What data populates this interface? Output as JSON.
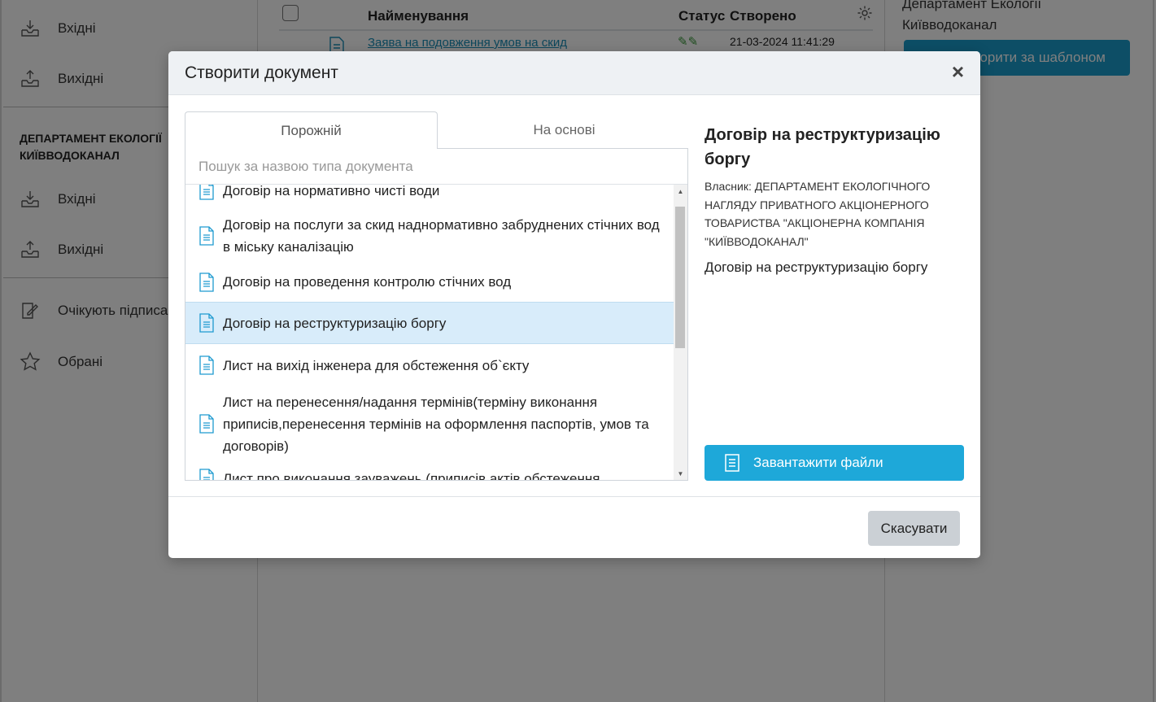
{
  "sidebar": {
    "items_top": [
      {
        "label": "Вхідні",
        "icon": "inbox-download-icon"
      },
      {
        "label": "Вихідні",
        "icon": "outbox-upload-icon"
      }
    ],
    "department_heading": "ДЕПАРТАМЕНТ ЕКОЛОГІЇ КИЇВВОДОКАНАЛ",
    "items_dept": [
      {
        "label": "Вхідні",
        "icon": "inbox-download-icon"
      },
      {
        "label": "Вихідні",
        "icon": "outbox-upload-icon"
      }
    ],
    "items_bottom": [
      {
        "label": "Очікують підписа",
        "icon": "signature-icon"
      },
      {
        "label": "Обрані",
        "icon": "star-icon"
      }
    ]
  },
  "table": {
    "headers": {
      "name": "Найменування",
      "status": "Статус",
      "created": "Створено"
    },
    "rows": [
      {
        "name": "Заява на подовження умов на скид",
        "status": "✎✎",
        "created": "21-03-2024 11:41:29"
      }
    ]
  },
  "right_panel": {
    "owner_line1": "Департамент Екології",
    "owner_line2": "Київводоканал",
    "template_button": "Створити за шаблоном"
  },
  "modal": {
    "title": "Створити документ",
    "close": "×",
    "tabs": [
      {
        "label": "Порожній",
        "active": true
      },
      {
        "label": "На основі",
        "active": false
      }
    ],
    "search_placeholder": "Пошук за назвою типа документа",
    "items": [
      {
        "label": "Договір на нормативно чисті води",
        "selected": false
      },
      {
        "label": "Договір на послуги за скид наднормативно забруднених стічних вод в міську каналізацію",
        "selected": false
      },
      {
        "label": "Договір на проведення контролю стічних вод",
        "selected": false
      },
      {
        "label": "Договір на реструктуризацію боргу",
        "selected": true
      },
      {
        "label": "Лист на вихід інженера для обстеження об`єкту",
        "selected": false
      },
      {
        "label": "Лист на перенесення/надання термінів(терміну виконання приписів,перенесення термінів на оформлення паспортів, умов та договорів)",
        "selected": false
      },
      {
        "label": "Лист про виконання зауважень (приписів актів обстеження",
        "selected": false
      }
    ],
    "detail": {
      "title": "Договір на реструктуризацію боргу",
      "owner": "Власник: ДЕПАРТАМЕНТ ЕКОЛОГІЧНОГО НАГЛЯДУ ПРИВАТНОГО АКЦІОНЕРНОГО ТОВАРИСТВА \"АКЦІОНЕРНА КОМПАНІЯ \"КИЇВВОДОКАНАЛ\"",
      "description": "Договір на реструктуризацію боргу",
      "upload_button": "Завантажити файли"
    },
    "cancel_button": "Скасувати"
  },
  "colors": {
    "accent": "#1ea8d9",
    "selected_row": "#d8ecfa",
    "link": "#1a8fb8"
  }
}
